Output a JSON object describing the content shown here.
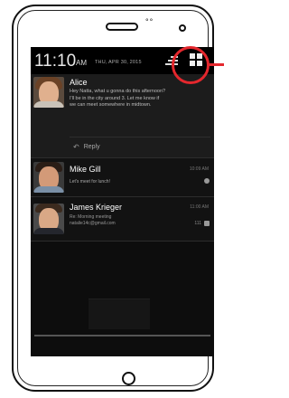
{
  "status_bar": {
    "time": "11:10",
    "ampm": "AM",
    "date": "THU, APR 30, 2015",
    "clear_icon": "clear-all-icon",
    "settings_icon": "quick-settings-icon"
  },
  "notifications": [
    {
      "sender": "Alice",
      "time": "",
      "message": "Hey Natta, what u gonna do this afternoon?\nI'll be in the city around 3. Let me know if\nwe can meet somewhere in midtown.",
      "action_label": "Reply",
      "action_icon": "reply-arrow-icon"
    },
    {
      "sender": "Mike Gill",
      "time": "10:09 AM",
      "message": "Let's meet for lunch!",
      "icon": "hangouts-icon"
    },
    {
      "sender": "James Krieger",
      "time": "11:00 AM",
      "subject": "Re: Morning meeting",
      "email": "natalie14c@gmail.com",
      "count": "111",
      "icon": "email-icon"
    }
  ],
  "colors": {
    "screen_background": "#0d0d0d",
    "highlight": "#e4272d"
  }
}
